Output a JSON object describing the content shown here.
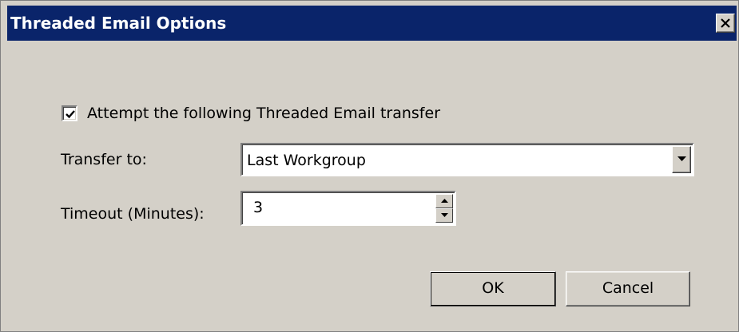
{
  "window": {
    "title": "Threaded Email Options",
    "close_icon": "close-icon"
  },
  "form": {
    "attempt_checkbox": {
      "label": "Attempt the following Threaded Email transfer",
      "checked": true
    },
    "transfer_to": {
      "label": "Transfer to:",
      "value": "Last Workgroup"
    },
    "timeout": {
      "label": "Timeout (Minutes):",
      "value": "3"
    }
  },
  "buttons": {
    "ok_label": "OK",
    "cancel_label": "Cancel"
  },
  "colors": {
    "titlebar": "#0a246a",
    "dialog_bg": "#d4d0c8"
  }
}
